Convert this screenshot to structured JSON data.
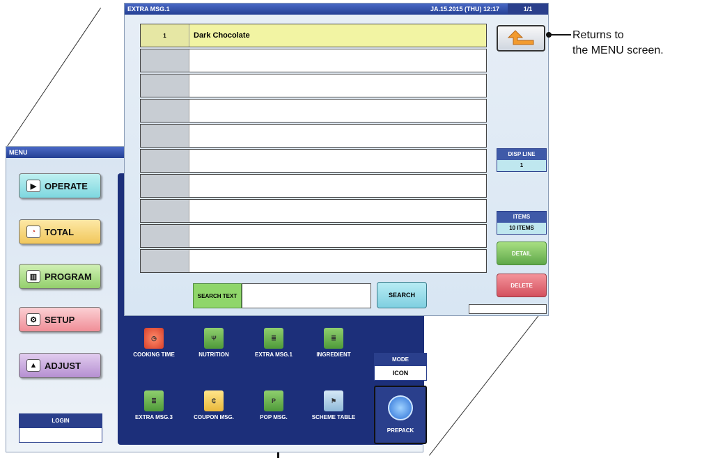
{
  "menu_window": {
    "title": "MENU",
    "buttons": [
      "OPERATE",
      "TOTAL",
      "PROGRAM",
      "SETUP",
      "ADJUST"
    ],
    "icons_row1": [
      "COOKING TIME",
      "NUTRITION",
      "EXTRA MSG.1",
      "INGREDIENT"
    ],
    "icons_row2": [
      "EXTRA MSG.3",
      "COUPON MSG.",
      "POP MSG.",
      "SCHEME TABLE"
    ],
    "mode_label": "MODE",
    "mode_value": "ICON",
    "prepack_label": "PREPACK",
    "login_label": "LOGIN"
  },
  "extra_window": {
    "title": "EXTRA MSG.1",
    "datetime": "JA.15.2015 (THU) 12:17",
    "page": "1/1",
    "rows": [
      {
        "num": "1",
        "text": "Dark Chocolate"
      },
      {
        "num": "",
        "text": ""
      },
      {
        "num": "",
        "text": ""
      },
      {
        "num": "",
        "text": ""
      },
      {
        "num": "",
        "text": ""
      },
      {
        "num": "",
        "text": ""
      },
      {
        "num": "",
        "text": ""
      },
      {
        "num": "",
        "text": ""
      },
      {
        "num": "",
        "text": ""
      },
      {
        "num": "",
        "text": ""
      }
    ],
    "disp_line_label": "DISP LINE",
    "disp_line_value": "1",
    "items_label": "ITEMS",
    "items_value": "10 ITEMS",
    "detail_label": "DETAIL",
    "delete_label": "DELETE",
    "search_text_label": "SEARCH TEXT",
    "search_value": "",
    "search_button": "SEARCH"
  },
  "annotation": {
    "line1": "Returns to",
    "line2": "the MENU screen."
  }
}
